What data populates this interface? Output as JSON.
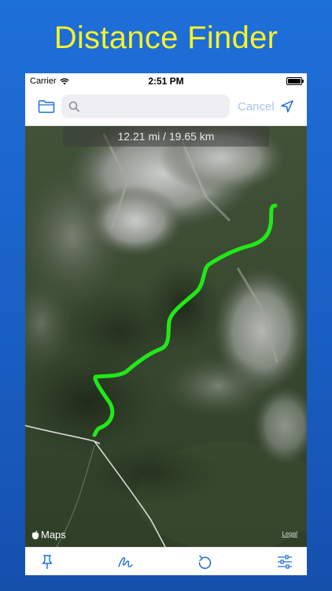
{
  "headline": "Distance Finder",
  "status_bar": {
    "carrier": "Carrier",
    "time": "2:51 PM"
  },
  "nav": {
    "search_placeholder": "",
    "cancel_label": "Cancel"
  },
  "map": {
    "distance_label": "12.21 mi / 19.65 km",
    "maps_label": "Maps",
    "legal_label": "Legal",
    "route_color": "#21e81a"
  },
  "toolbar": {
    "items": [
      "pin-icon",
      "draw-icon",
      "undo-icon",
      "settings-icon"
    ]
  },
  "colors": {
    "accent": "#1a6fd6",
    "headline": "#f6f229",
    "background": "#1f6fd9"
  }
}
